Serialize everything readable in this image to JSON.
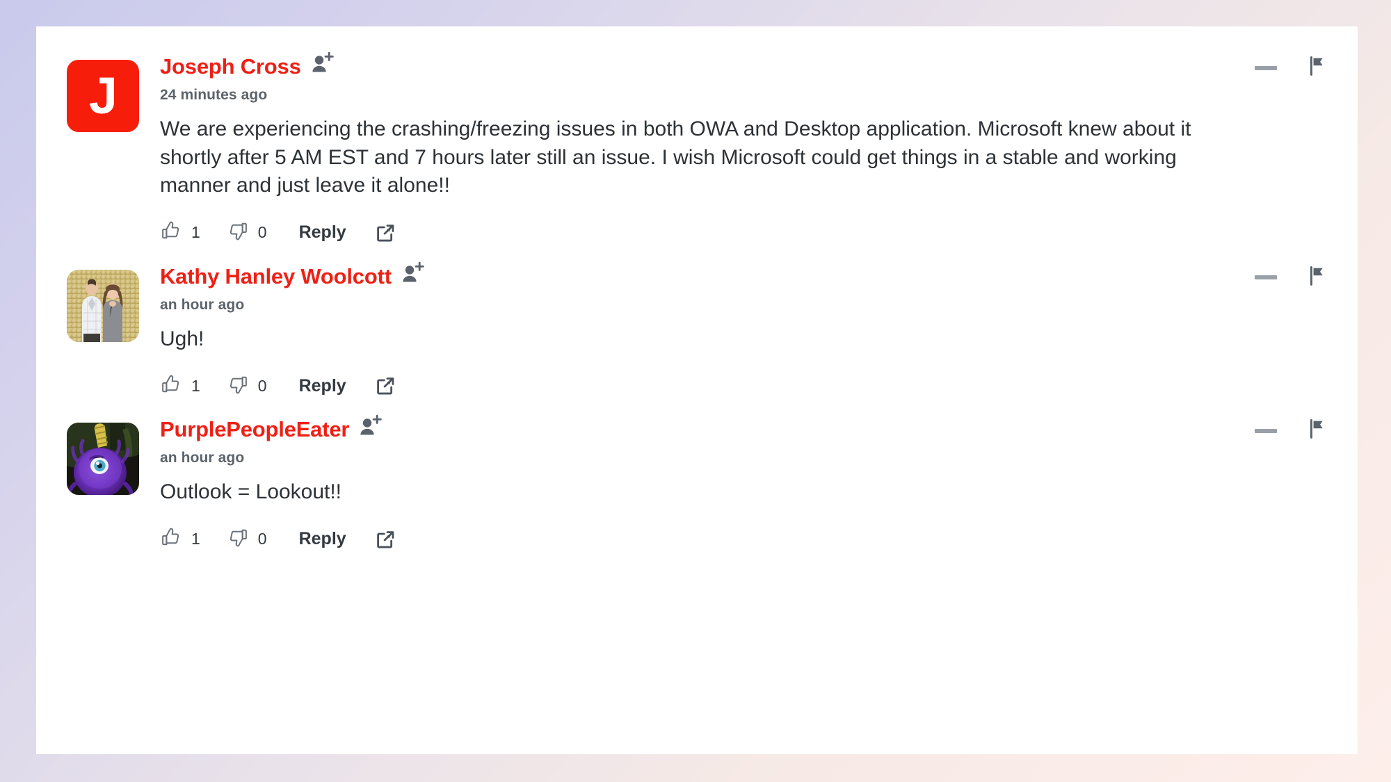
{
  "theme": {
    "card_background": "#ffffff",
    "page_gradient_start": "#c9caec",
    "page_gradient_end": "#fdeeea",
    "author_name_color": "#ee2015",
    "body_text_color": "#2d3237",
    "timestamp_color": "#5c636b",
    "icon_color": "#5b626c",
    "avatar_accent": "#f71d0b"
  },
  "labels": {
    "reply": "Reply",
    "add_person_icon": "add-person-icon",
    "like_icon": "thumbs-up-icon",
    "dislike_icon": "thumbs-down-icon",
    "share_icon": "share-icon",
    "collapse_icon": "collapse-icon",
    "flag_icon": "flag-icon"
  },
  "comments": [
    {
      "author": "Joseph Cross",
      "timestamp": "24 minutes ago",
      "text": "We are experiencing the crashing/freezing issues in both OWA and Desktop application. Microsoft knew about it shortly after 5 AM EST and 7 hours later still an issue. I wish Microsoft could get things in a stable and working manner and just leave it alone!!",
      "likes": "1",
      "dislikes": "0",
      "reply": "Reply",
      "avatar_type": "initial",
      "avatar_initial": "J"
    },
    {
      "author": "Kathy Hanley Woolcott",
      "timestamp": "an hour ago",
      "text": "Ugh!",
      "likes": "1",
      "dislikes": "0",
      "reply": "Reply",
      "avatar_type": "photo-couple",
      "avatar_initial": ""
    },
    {
      "author": "PurplePeopleEater",
      "timestamp": "an hour ago",
      "text": "Outlook = Lookout!!",
      "likes": "1",
      "dislikes": "0",
      "reply": "Reply",
      "avatar_type": "photo-monster",
      "avatar_initial": ""
    }
  ]
}
